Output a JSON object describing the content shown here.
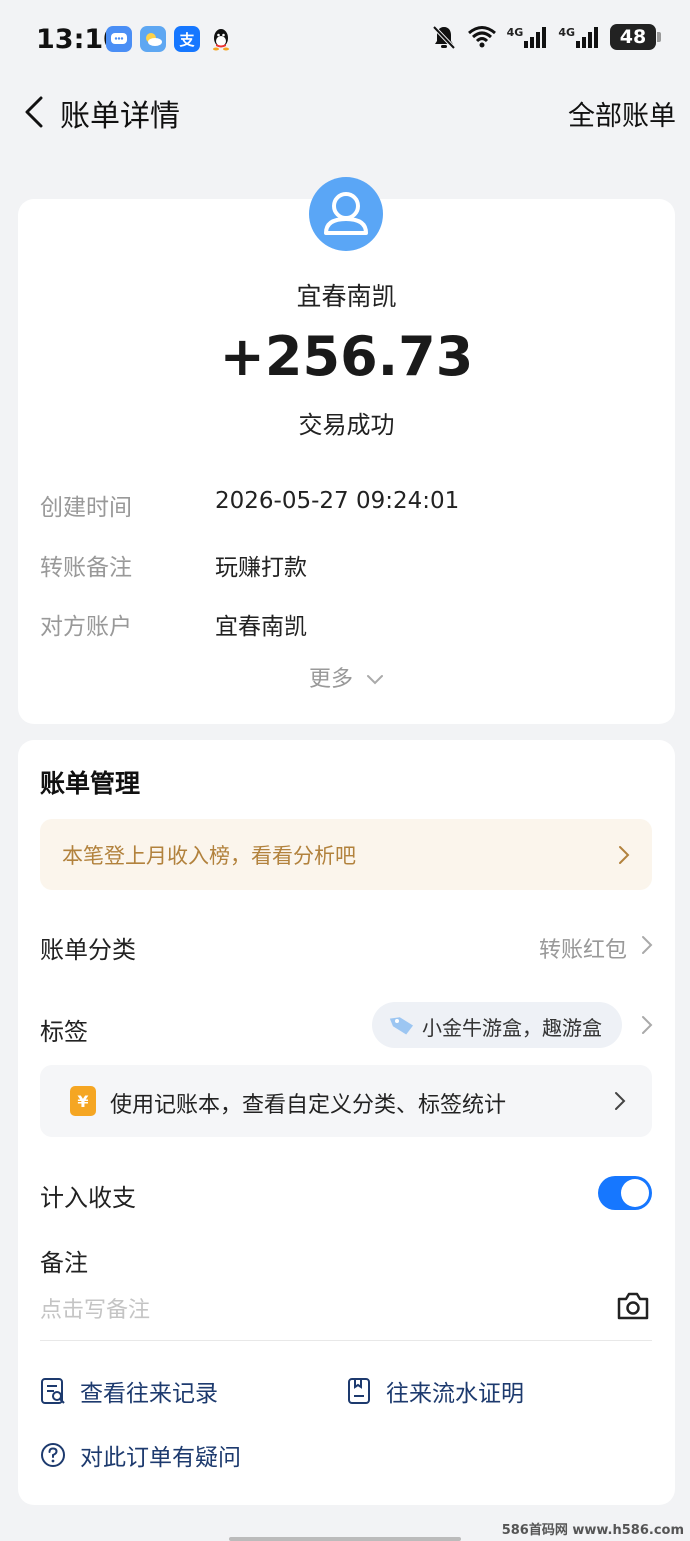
{
  "status_bar": {
    "time": "13:10",
    "battery": "48",
    "network_1": "4G",
    "network_2": "4G"
  },
  "header": {
    "title": "账单详情",
    "all_bills_label": "全部账单"
  },
  "transaction": {
    "merchant": "宜春南凯",
    "amount": "+256.73",
    "status": "交易成功",
    "details": [
      {
        "label": "创建时间",
        "value": "2026-05-27 09:24:01"
      },
      {
        "label": "转账备注",
        "value": "玩赚打款"
      },
      {
        "label": "对方账户",
        "value": "宜春南凯"
      }
    ],
    "more_label": "更多"
  },
  "management": {
    "title": "账单管理",
    "promo_text": "本笔登上月收入榜，看看分析吧",
    "category_label": "账单分类",
    "category_value": "转账红包",
    "tag_label": "标签",
    "tag_value": "小金牛游盒，趣游盒",
    "notebook_text": "使用记账本，查看自定义分类、标签统计",
    "notebook_icon_text": "¥",
    "count_label": "计入收支",
    "count_enabled": true,
    "note_label": "备注",
    "note_placeholder": "点击写备注",
    "links": {
      "history": "查看往来记录",
      "proof": "往来流水证明",
      "question": "对此订单有疑问"
    }
  },
  "watermark": "586首码网 www.h586.com",
  "colors": {
    "accent": "#1677ff",
    "avatar": "#5aa6f6",
    "promo_text": "#b2823d",
    "link": "#1d3a6e"
  }
}
